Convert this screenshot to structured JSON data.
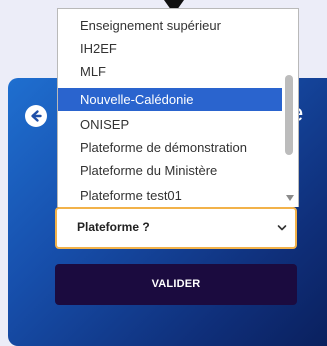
{
  "header": {
    "partial_title": "e"
  },
  "dropdown": {
    "options": [
      "Enseignement supérieur",
      "IH2EF",
      "MLF",
      "Nouvelle-Calédonie",
      "ONISEP",
      "Plateforme de démonstration",
      "Plateforme du Ministère",
      "Plateforme test01"
    ],
    "highlighted": "Nouvelle-Calédonie"
  },
  "select": {
    "value": "Plateforme ?"
  },
  "submit": {
    "label": "VALIDER"
  },
  "icons": {
    "back": "arrow-left-circle-icon",
    "chevron": "chevron-down-icon",
    "pointer": "triangle-down-icon"
  },
  "colors": {
    "highlight": "#2a64ce",
    "select_border": "#f2b24a",
    "button_bg": "#1b0b3f",
    "card_start": "#1f6fd0",
    "card_end": "#0a1f5c"
  }
}
